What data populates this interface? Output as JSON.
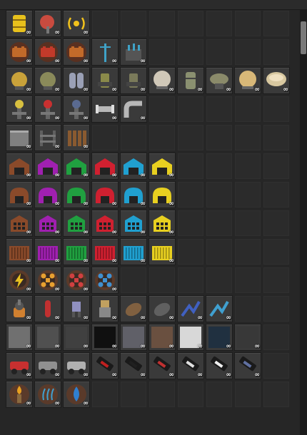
{
  "ui": {
    "count_label": "∞",
    "columns": 10,
    "rows": 14
  },
  "slots": [
    [
      {
        "icon": "barrel-icon",
        "color": "#e8c11c"
      },
      {
        "icon": "satellite-dish-icon",
        "color": "#c94b3f"
      },
      {
        "icon": "radio-signal-icon",
        "color": "#f2c21c"
      },
      null,
      null,
      null,
      null,
      null,
      null,
      null
    ],
    [
      {
        "icon": "battery-icon",
        "color": "#c26a2a"
      },
      {
        "icon": "battery-icon",
        "color": "#c23a2a"
      },
      {
        "icon": "battery-icon",
        "color": "#c26a2a"
      },
      {
        "icon": "power-pole-icon",
        "color": "#3fa2c7"
      },
      {
        "icon": "substation-icon",
        "color": "#3fa2c7"
      },
      null,
      null,
      null,
      null,
      null
    ],
    [
      {
        "icon": "storage-tank-icon",
        "color": "#c9a23a"
      },
      {
        "icon": "storage-tank-icon",
        "color": "#8a8a5a"
      },
      {
        "icon": "gas-canisters-icon",
        "color": "#9aa0b5"
      },
      {
        "icon": "pump-icon",
        "color": "#8a8a4a"
      },
      {
        "icon": "pump-icon",
        "color": "#7a7a5a"
      },
      {
        "icon": "sphere-tank-icon",
        "color": "#d0c8b8"
      },
      {
        "icon": "cylinder-tank-icon",
        "color": "#8a9070"
      },
      {
        "icon": "bowl-tank-icon",
        "color": "#8a8a6a"
      },
      {
        "icon": "sphere-tank-icon",
        "color": "#d8b878"
      },
      {
        "icon": "flat-tank-icon",
        "color": "#d8c8a0"
      }
    ],
    [
      {
        "icon": "valve-icon",
        "color": "#d8c040"
      },
      {
        "icon": "valve-icon",
        "color": "#c83030"
      },
      {
        "icon": "valve-icon",
        "color": "#5a6a90"
      },
      {
        "icon": "pipe-straight-icon",
        "color": "#b8b8b8"
      },
      {
        "icon": "pipe-elbow-icon",
        "color": "#b8b8b8"
      },
      null,
      null,
      null,
      null,
      null
    ],
    [
      {
        "icon": "wall-icon",
        "color": "#808080"
      },
      {
        "icon": "fence-icon",
        "color": "#606060"
      },
      {
        "icon": "wood-fence-icon",
        "color": "#8a5a30"
      },
      null,
      null,
      null,
      null,
      null,
      null,
      null
    ],
    [
      {
        "icon": "warehouse-icon",
        "color": "#8a4a2a"
      },
      {
        "icon": "warehouse-icon",
        "color": "#a020b0"
      },
      {
        "icon": "warehouse-icon",
        "color": "#20a040"
      },
      {
        "icon": "warehouse-icon",
        "color": "#d02030"
      },
      {
        "icon": "warehouse-icon",
        "color": "#20a0d0"
      },
      {
        "icon": "warehouse-icon",
        "color": "#e8d020"
      },
      null,
      null,
      null,
      null
    ],
    [
      {
        "icon": "hangar-icon",
        "color": "#8a4a2a"
      },
      {
        "icon": "hangar-icon",
        "color": "#a020b0"
      },
      {
        "icon": "hangar-icon",
        "color": "#20a040"
      },
      {
        "icon": "hangar-icon",
        "color": "#d02030"
      },
      {
        "icon": "hangar-icon",
        "color": "#20a0d0"
      },
      {
        "icon": "hangar-icon",
        "color": "#e8d020"
      },
      null,
      null,
      null,
      null
    ],
    [
      {
        "icon": "storehouse-icon",
        "color": "#8a4a2a"
      },
      {
        "icon": "storehouse-icon",
        "color": "#a020b0"
      },
      {
        "icon": "storehouse-icon",
        "color": "#20a040"
      },
      {
        "icon": "storehouse-icon",
        "color": "#d02030"
      },
      {
        "icon": "storehouse-icon",
        "color": "#20a0d0"
      },
      {
        "icon": "storehouse-icon",
        "color": "#e8d020"
      },
      null,
      null,
      null,
      null
    ],
    [
      {
        "icon": "container-icon",
        "color": "#8a4a2a"
      },
      {
        "icon": "container-icon",
        "color": "#a020b0"
      },
      {
        "icon": "container-icon",
        "color": "#20a040"
      },
      {
        "icon": "container-icon",
        "color": "#d02030"
      },
      {
        "icon": "container-icon",
        "color": "#20a0d0"
      },
      {
        "icon": "container-icon",
        "color": "#e8d020"
      },
      null,
      null,
      null,
      null
    ],
    [
      {
        "icon": "lightning-gear-icon",
        "color": "#e8c020"
      },
      {
        "icon": "drone-gear-icon",
        "color": "#e8a030"
      },
      {
        "icon": "drone-gear-icon",
        "color": "#d04040"
      },
      {
        "icon": "drone-gear-icon",
        "color": "#4090d0"
      },
      null,
      null,
      null,
      null,
      null,
      null
    ],
    [
      {
        "icon": "turret-icon",
        "color": "#d08030"
      },
      {
        "icon": "missile-icon",
        "color": "#c03030"
      },
      {
        "icon": "mech-icon",
        "color": "#9090c0"
      },
      {
        "icon": "robot-icon",
        "color": "#c0a060"
      },
      {
        "icon": "shell-icon",
        "color": "#806040"
      },
      {
        "icon": "shell-icon",
        "color": "#606060"
      },
      {
        "icon": "claw-icon",
        "color": "#4060c0"
      },
      {
        "icon": "claw-icon",
        "color": "#40a0d0"
      },
      null,
      null
    ],
    [
      {
        "icon": "floor-tile-icon",
        "color": "#707070"
      },
      {
        "icon": "floor-tile-icon",
        "color": "#505050"
      },
      {
        "icon": "floor-tile-icon",
        "color": "#404040"
      },
      {
        "icon": "floor-tile-icon",
        "color": "#101010"
      },
      {
        "icon": "floor-tile-icon",
        "color": "#606068"
      },
      {
        "icon": "floor-tile-icon",
        "color": "#6a5040"
      },
      {
        "icon": "floor-tile-icon",
        "color": "#d8d8d8"
      },
      {
        "icon": "floor-tile-icon",
        "color": "#203040"
      },
      {
        "icon": "floor-tile-icon",
        "color": "#383838"
      },
      null
    ],
    [
      {
        "icon": "vehicle-icon",
        "color": "#c83030"
      },
      {
        "icon": "vehicle-icon",
        "color": "#909090"
      },
      {
        "icon": "vehicle-icon",
        "color": "#b0b0b0"
      },
      {
        "icon": "module-icon",
        "color": "#c02020"
      },
      {
        "icon": "module-icon",
        "color": "#202020"
      },
      {
        "icon": "module-icon",
        "color": "#c03030"
      },
      {
        "icon": "module-icon",
        "color": "#e0e0e0"
      },
      {
        "icon": "module-icon",
        "color": "#f0f0f0"
      },
      {
        "icon": "module-icon",
        "color": "#6070a0"
      },
      null
    ],
    [
      {
        "icon": "flame-lamp-icon",
        "color": "#e8a020"
      },
      {
        "icon": "heat-vent-icon",
        "color": "#40a0d0"
      },
      {
        "icon": "water-drop-icon",
        "color": "#3080d0"
      },
      null,
      null,
      null,
      null,
      null,
      null,
      null
    ]
  ]
}
